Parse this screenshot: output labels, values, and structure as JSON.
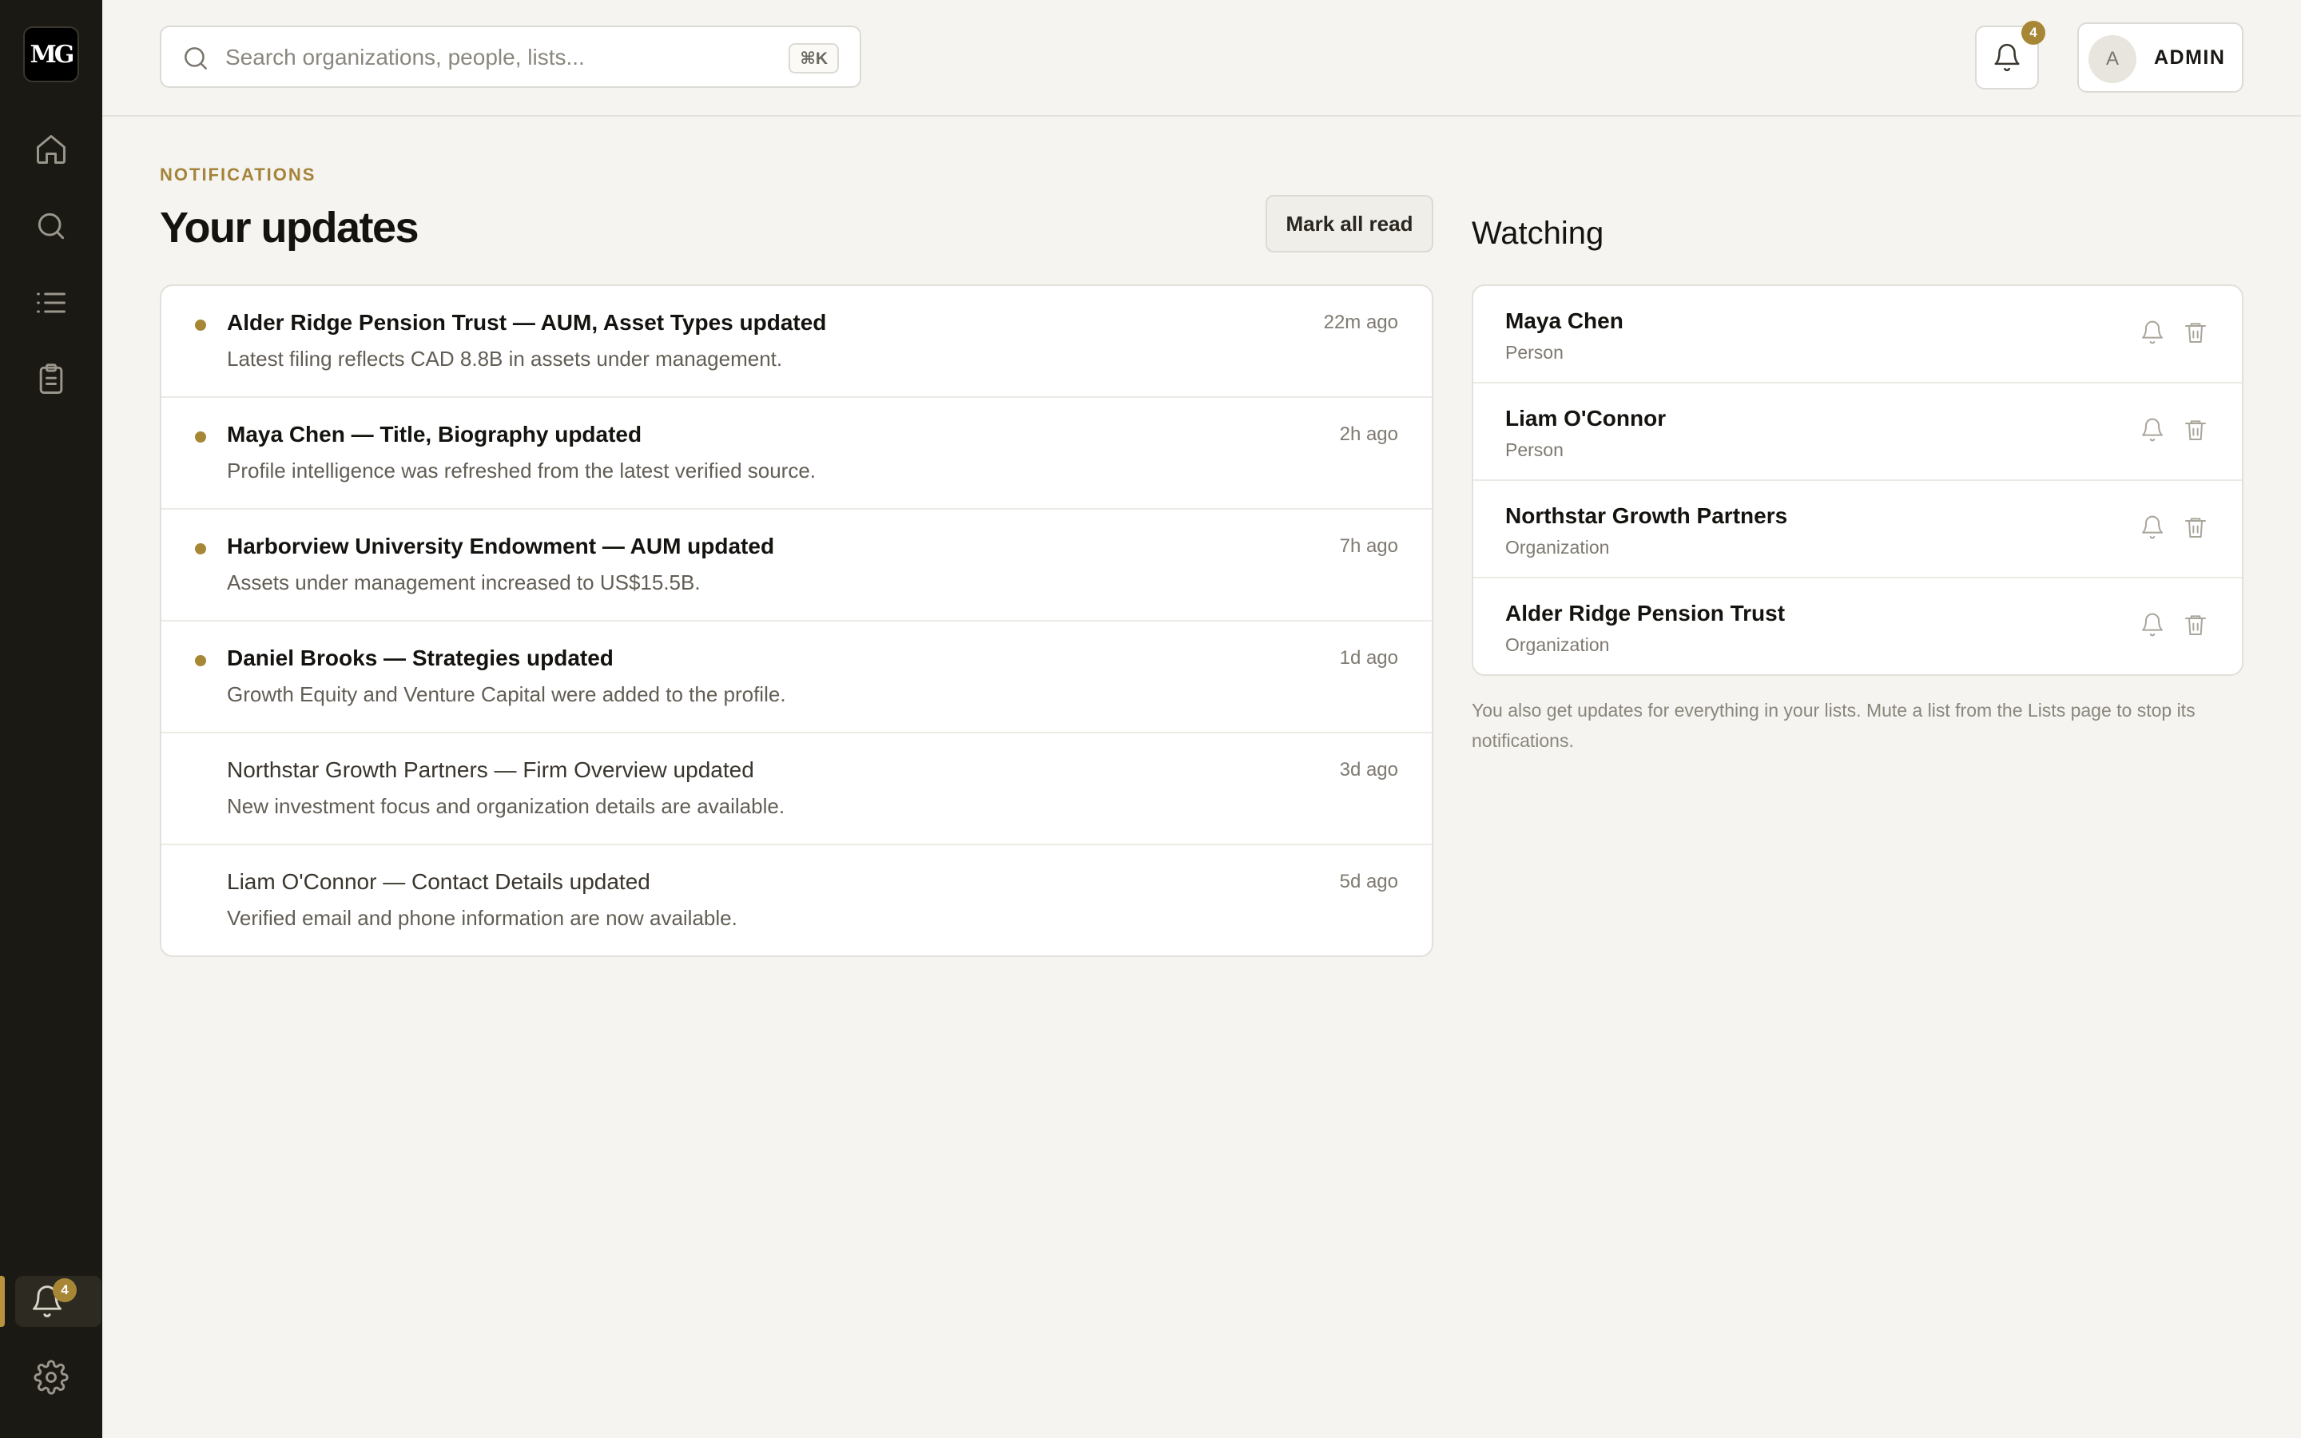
{
  "colors": {
    "sidebar_bg": "#1b1913",
    "accent": "#a78635",
    "page_bg": "#f5f4f0"
  },
  "sidebar": {
    "logo": "MG",
    "items": [
      {
        "icon": "home-icon"
      },
      {
        "icon": "search-icon"
      },
      {
        "icon": "list-icon"
      },
      {
        "icon": "clipboard-icon"
      }
    ],
    "notifications_badge": "4",
    "settings_icon": "gear-icon"
  },
  "search": {
    "placeholder": "Search organizations, people, lists...",
    "shortcut": "⌘K"
  },
  "header": {
    "bell_badge": "4",
    "avatar_initial": "A",
    "user_label": "ADMIN"
  },
  "notifications": {
    "section_label": "NOTIFICATIONS",
    "title": "Your updates",
    "mark_all_read": "Mark all read",
    "items": [
      {
        "title": "Alder Ridge Pension Trust — AUM, Asset Types updated",
        "description": "Latest filing reflects CAD 8.8B in assets under management.",
        "time": "22m ago",
        "unread": true
      },
      {
        "title": "Maya Chen — Title, Biography updated",
        "description": "Profile intelligence was refreshed from the latest verified source.",
        "time": "2h ago",
        "unread": true
      },
      {
        "title": "Harborview University Endowment — AUM updated",
        "description": "Assets under management increased to US$15.5B.",
        "time": "7h ago",
        "unread": true
      },
      {
        "title": "Daniel Brooks — Strategies updated",
        "description": "Growth Equity and Venture Capital were added to the profile.",
        "time": "1d ago",
        "unread": true
      },
      {
        "title": "Northstar Growth Partners — Firm Overview updated",
        "description": "New investment focus and organization details are available.",
        "time": "3d ago",
        "unread": false
      },
      {
        "title": "Liam O'Connor — Contact Details updated",
        "description": "Verified email and phone information are now available.",
        "time": "5d ago",
        "unread": false
      }
    ]
  },
  "watching": {
    "title": "Watching",
    "items": [
      {
        "name": "Maya Chen",
        "type": "Person"
      },
      {
        "name": "Liam O'Connor",
        "type": "Person"
      },
      {
        "name": "Northstar Growth Partners",
        "type": "Organization"
      },
      {
        "name": "Alder Ridge Pension Trust",
        "type": "Organization"
      }
    ],
    "footnote": "You also get updates for everything in your lists. Mute a list from the Lists page to stop its notifications."
  }
}
